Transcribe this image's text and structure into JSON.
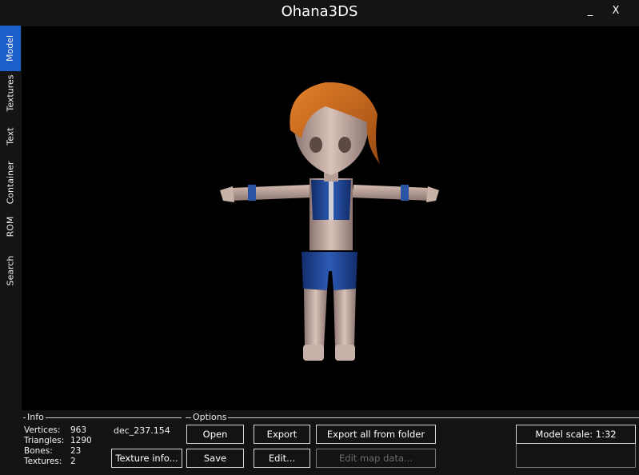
{
  "window": {
    "title": "Ohana3DS",
    "minimize_label": "_",
    "close_label": "X"
  },
  "sidebar": {
    "tabs": [
      {
        "label": "Model",
        "active": true
      },
      {
        "label": "Textures",
        "active": false
      },
      {
        "label": "Text",
        "active": false
      },
      {
        "label": "Container",
        "active": false
      },
      {
        "label": "ROM",
        "active": false
      },
      {
        "label": "Search",
        "active": false
      }
    ]
  },
  "info": {
    "group_label": "Info",
    "vertices_label": "Vertices:",
    "vertices_value": "963",
    "triangles_label": "Triangles:",
    "triangles_value": "1290",
    "bones_label": "Bones:",
    "bones_value": "23",
    "textures_label": "Textures:",
    "textures_value": "2",
    "file_name": "dec_237.154",
    "texture_info_button": "Texture info..."
  },
  "options": {
    "group_label": "Options",
    "open_button": "Open",
    "export_button": "Export",
    "export_all_button": "Export all from folder",
    "save_button": "Save",
    "edit_button": "Edit...",
    "edit_map_button": "Edit map data..."
  },
  "model_scale_button": "Model scale: 1:32",
  "colors": {
    "accent": "#1d5fc9",
    "viewport_bg": "#000000",
    "panel_bg": "#131313"
  }
}
